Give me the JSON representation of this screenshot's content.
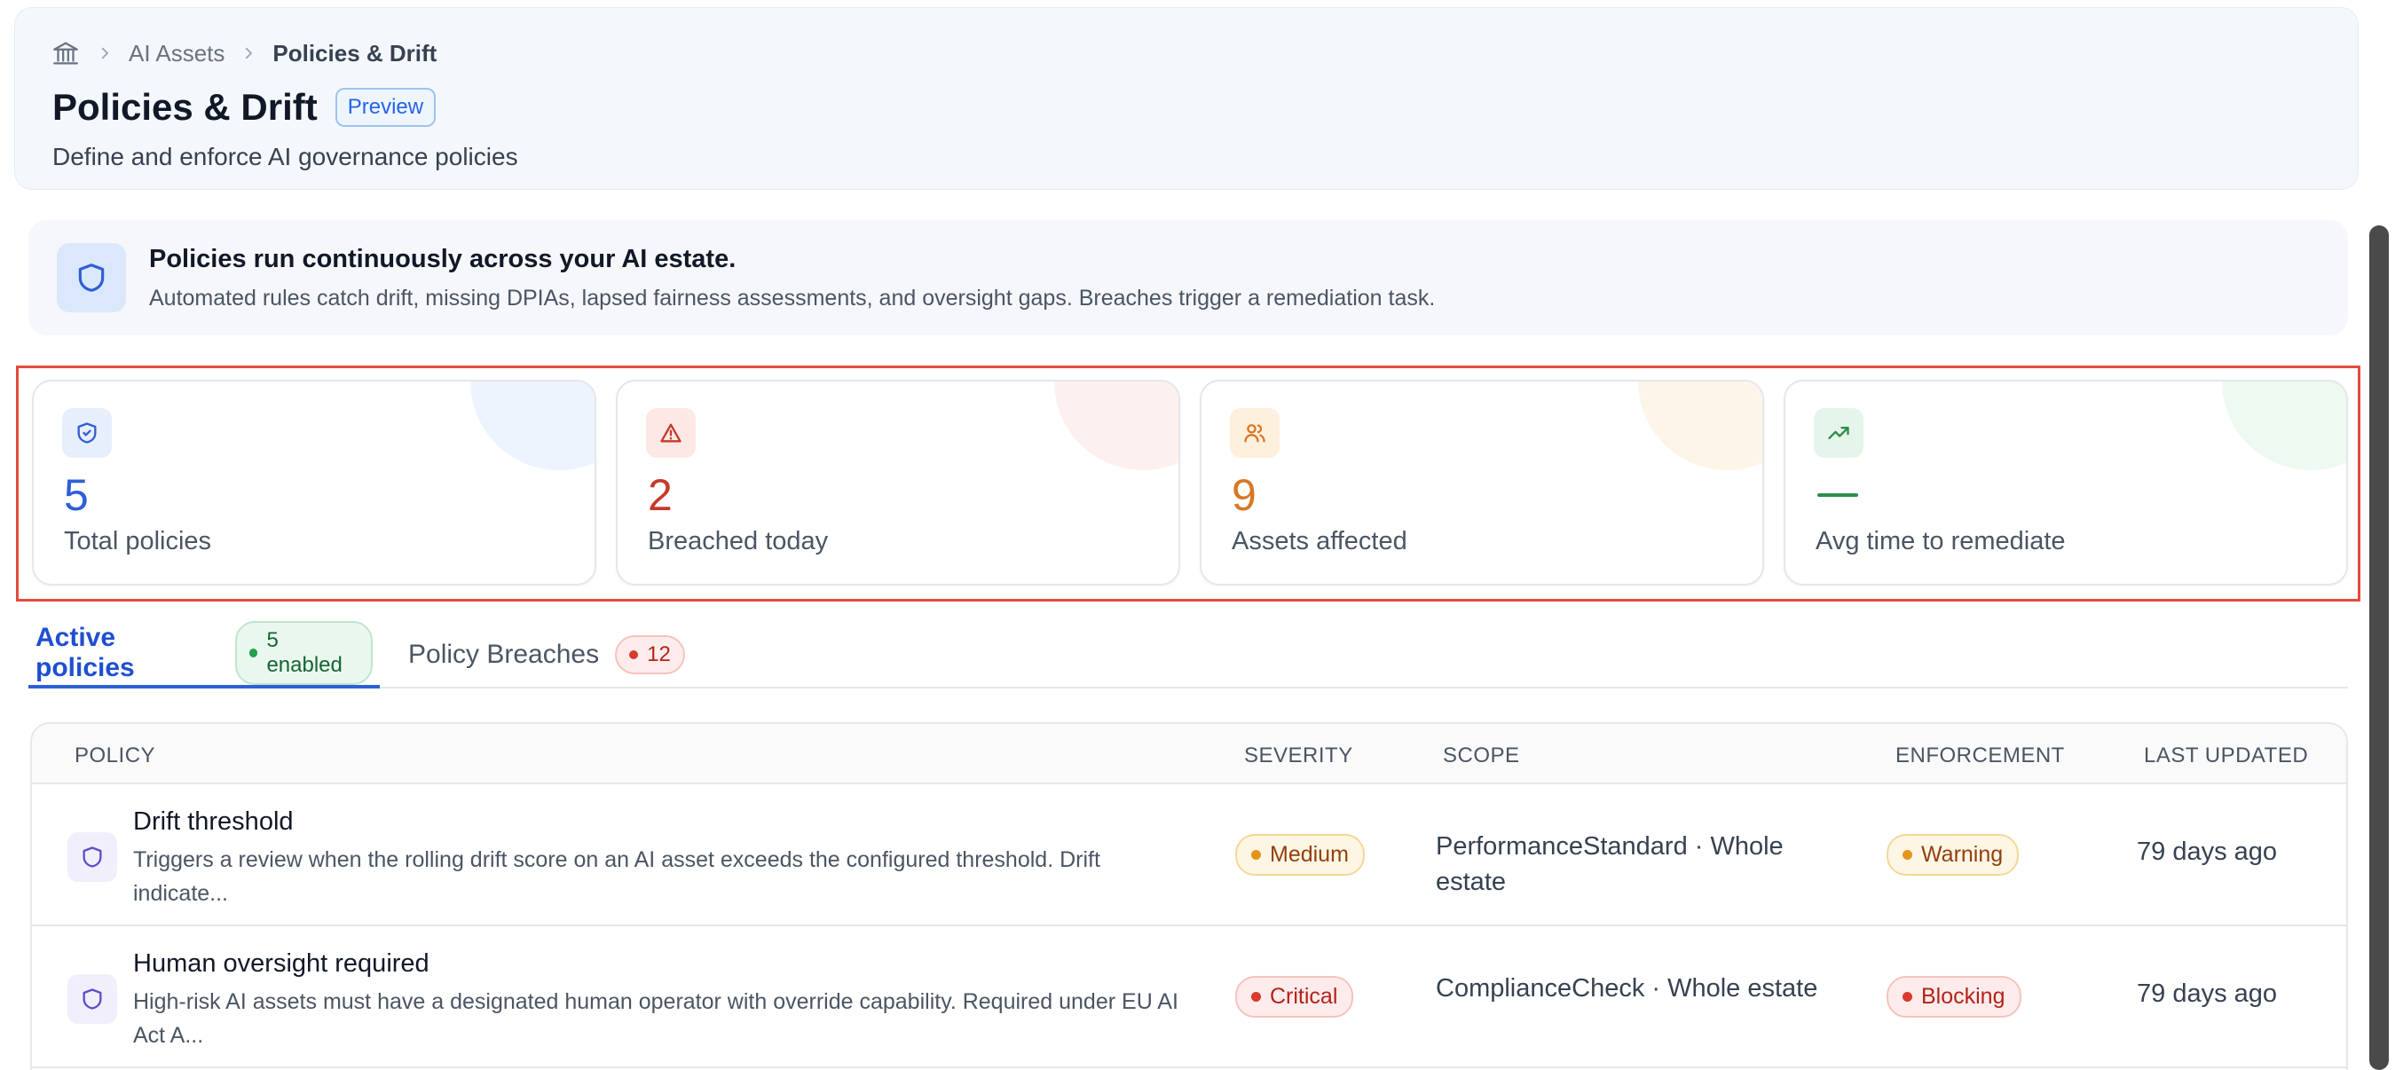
{
  "breadcrumb": {
    "items": [
      "AI Assets",
      "Policies & Drift"
    ]
  },
  "header": {
    "title": "Policies & Drift",
    "badge": "Preview",
    "subtitle": "Define and enforce AI governance policies"
  },
  "banner": {
    "title": "Policies run continuously across your AI estate.",
    "text": "Automated rules catch drift, missing DPIAs, lapsed fairness assessments, and oversight gaps. Breaches trigger a remediation task.",
    "icon": "shield-icon"
  },
  "stats": [
    {
      "value": "5",
      "label": "Total policies",
      "icon": "shield-check-icon",
      "color": "#2f5fd6"
    },
    {
      "value": "2",
      "label": "Breached today",
      "icon": "alert-triangle-icon",
      "color": "#c53a2b"
    },
    {
      "value": "9",
      "label": "Assets affected",
      "icon": "users-icon",
      "color": "#d97724"
    },
    {
      "value": "—",
      "label": "Avg time to remediate",
      "icon": "trending-up-icon",
      "color": "#2f8a4c"
    }
  ],
  "tabs": [
    {
      "label": "Active policies",
      "pill": "5 enabled",
      "active": true
    },
    {
      "label": "Policy Breaches",
      "pill": "12",
      "active": false
    }
  ],
  "table": {
    "headers": [
      "POLICY",
      "SEVERITY",
      "SCOPE",
      "ENFORCEMENT",
      "LAST UPDATED"
    ],
    "rows": [
      {
        "title": "Drift threshold",
        "description": "Triggers a review when the rolling drift score on an AI asset exceeds the configured threshold. Drift indicate...",
        "severity": "Medium",
        "scope": "PerformanceStandard · Whole estate",
        "enforcement": "Warning",
        "updated": "79 days ago"
      },
      {
        "title": "Human oversight required",
        "description": "High-risk AI assets must have a designated human operator with override capability. Required under EU AI Act A...",
        "severity": "Critical",
        "scope": "ComplianceCheck · Whole estate",
        "enforcement": "Blocking",
        "updated": "79 days ago"
      }
    ]
  }
}
